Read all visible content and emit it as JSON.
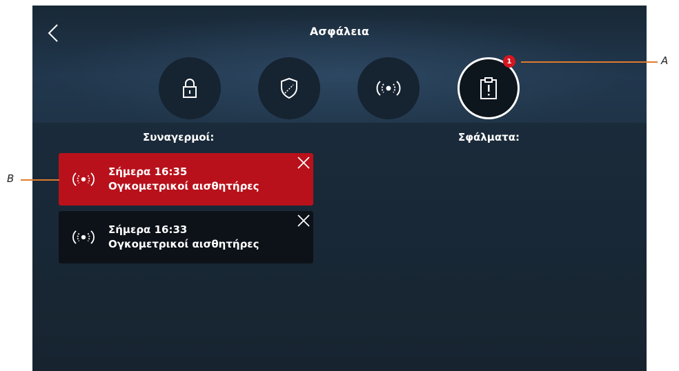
{
  "header": {
    "title": "Ασφάλεια"
  },
  "tabs": [
    {
      "name": "lock"
    },
    {
      "name": "shield"
    },
    {
      "name": "alarm"
    },
    {
      "name": "clipboard-alert",
      "active": true,
      "badge": "1"
    }
  ],
  "sections": {
    "alarms_title": "Συναγερμοί:",
    "faults_title": "Σφάλματα:"
  },
  "alarms": [
    {
      "time": "Σήμερα 16:35",
      "sensor": "Ογκομετρικοί αισθητήρες",
      "color": "#b8111b"
    },
    {
      "time": "Σήμερα 16:33",
      "sensor": "Ογκομετρικοί αισθητήρες",
      "color": "#0d1218"
    }
  ],
  "callouts": {
    "a": "A",
    "b": "B"
  },
  "colors": {
    "callout_line": "#e07b2c",
    "badge": "#d5161f"
  }
}
